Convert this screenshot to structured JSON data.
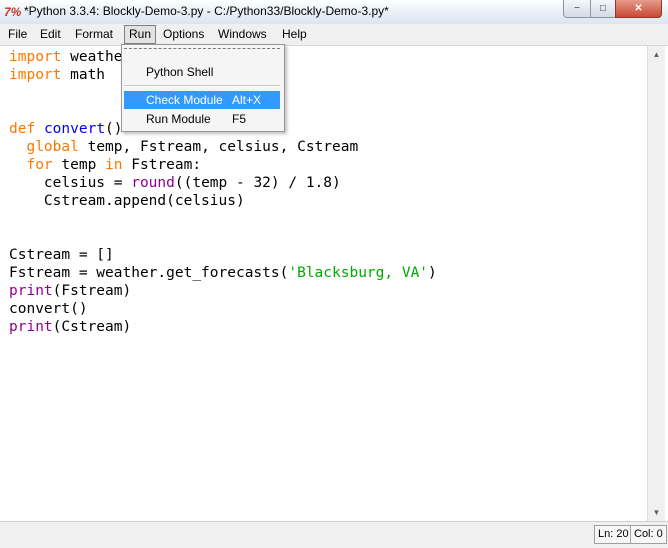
{
  "window": {
    "title": "*Python 3.3.4: Blockly-Demo-3.py - C:/Python33/Blockly-Demo-3.py*",
    "icon": "python-idle-icon",
    "controls": {
      "minimize": "−",
      "maximize": "□",
      "close": "✕"
    }
  },
  "menubar": {
    "file": "File",
    "edit": "Edit",
    "format": "Format",
    "run": "Run",
    "options": "Options",
    "windows": "Windows",
    "help": "Help"
  },
  "run_menu": {
    "items": [
      {
        "label": "Python Shell",
        "accel": ""
      },
      {
        "label": "Check Module",
        "accel": "Alt+X",
        "highlighted": true
      },
      {
        "label": "Run Module",
        "accel": "F5"
      }
    ]
  },
  "code": {
    "lines": [
      [
        {
          "t": "import",
          "c": "kw"
        },
        {
          "t": " weather"
        }
      ],
      [
        {
          "t": "import",
          "c": "kw"
        },
        {
          "t": " math"
        }
      ],
      [],
      [],
      [
        {
          "t": "def",
          "c": "kw"
        },
        {
          "t": " "
        },
        {
          "t": "convert",
          "c": "df"
        },
        {
          "t": "()"
        }
      ],
      [
        {
          "t": "  "
        },
        {
          "t": "global",
          "c": "kw"
        },
        {
          "t": " temp, Fstream, celsius, Cstream"
        }
      ],
      [
        {
          "t": "  "
        },
        {
          "t": "for",
          "c": "kw"
        },
        {
          "t": " temp "
        },
        {
          "t": "in",
          "c": "kw"
        },
        {
          "t": " Fstream:"
        }
      ],
      [
        {
          "t": "    celsius = "
        },
        {
          "t": "round",
          "c": "bi"
        },
        {
          "t": "((temp - 32) / 1.8)"
        }
      ],
      [
        {
          "t": "    Cstream.append(celsius)"
        }
      ],
      [],
      [],
      [
        {
          "t": "Cstream = []"
        }
      ],
      [
        {
          "t": "Fstream = weather.get_forecasts("
        },
        {
          "t": "'Blacksburg, VA'",
          "c": "st"
        },
        {
          "t": ")"
        }
      ],
      [
        {
          "t": "print",
          "c": "bi"
        },
        {
          "t": "(Fstream)"
        }
      ],
      [
        {
          "t": "convert()"
        }
      ],
      [
        {
          "t": "print",
          "c": "bi"
        },
        {
          "t": "(Cstream)"
        }
      ]
    ]
  },
  "scrollbar": {
    "up_icon": "up-arrow-icon",
    "down_icon": "down-arrow-icon",
    "up": "▲",
    "down": "▼"
  },
  "status": {
    "line": "Ln: 20",
    "col": "Col: 0"
  },
  "colors": {
    "keyword": "#ff7700",
    "definition": "#0000ff",
    "string": "#00aa00",
    "builtin": "#900090",
    "highlight": "#3399ff"
  }
}
